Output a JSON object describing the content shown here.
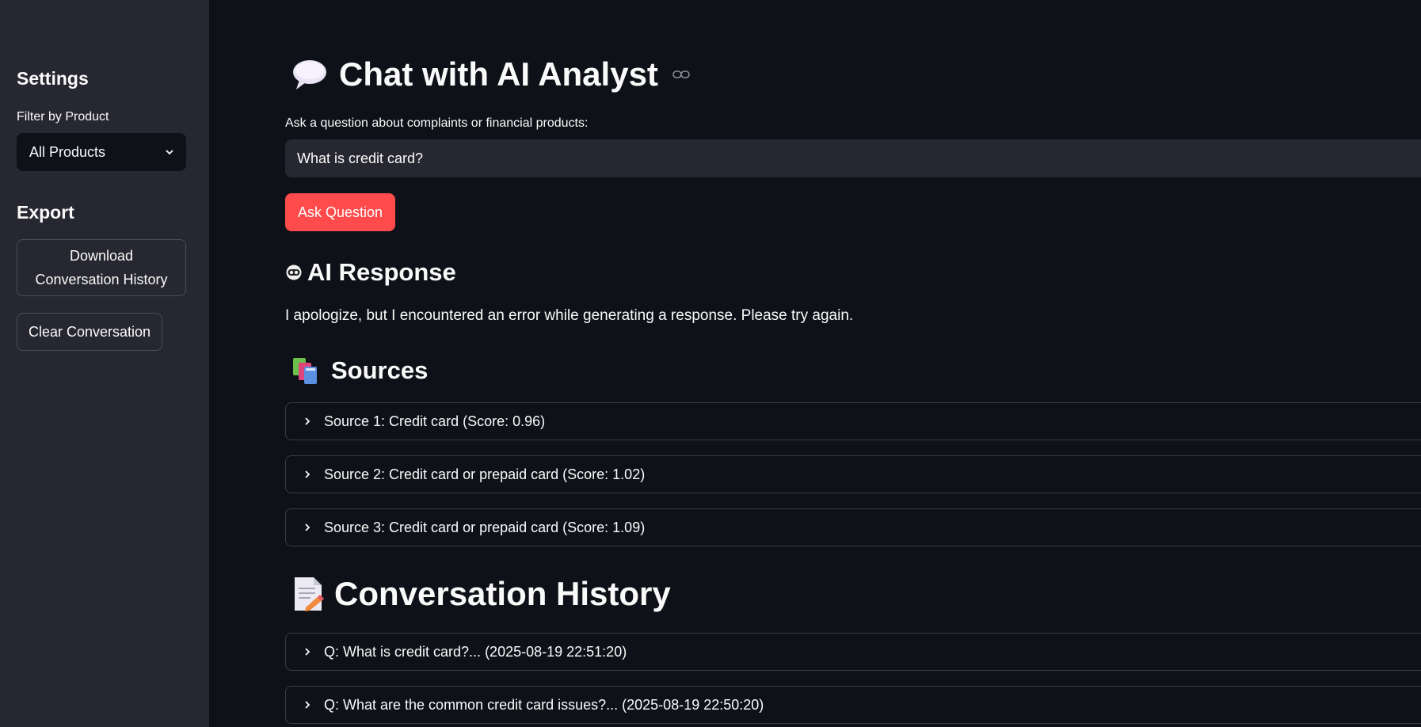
{
  "sidebar": {
    "settings_heading": "Settings",
    "filter_label": "Filter by Product",
    "filter_value": "All Products",
    "export_heading": "Export",
    "download_button": "Download Conversation History",
    "clear_button": "Clear Conversation"
  },
  "main": {
    "title": "Chat with AI Analyst",
    "question_label": "Ask a question about complaints or financial products:",
    "question_value": "What is credit card?",
    "ask_button": "Ask Question",
    "response_heading": "AI Response",
    "response_text": "I apologize, but I encountered an error while generating a response. Please try again.",
    "sources_heading": "Sources",
    "sources": [
      {
        "label": "Source 1: Credit card (Score: 0.96)"
      },
      {
        "label": "Source 2: Credit card or prepaid card (Score: 1.02)"
      },
      {
        "label": "Source 3: Credit card or prepaid card (Score: 1.09)"
      }
    ],
    "history_heading": "Conversation History",
    "history": [
      {
        "label": "Q: What is credit card?... (2025-08-19 22:51:20)"
      },
      {
        "label": "Q: What are the common credit card issues?... (2025-08-19 22:50:20)"
      }
    ]
  },
  "icons": {
    "title": "speech-balloon-icon",
    "response": "robot-icon",
    "sources": "books-icon",
    "history": "memo-icon",
    "anchor": "link-icon"
  },
  "colors": {
    "background": "#0e1117",
    "sidebar": "#262730",
    "primary": "#ff4b4b",
    "text": "#fafafa"
  }
}
